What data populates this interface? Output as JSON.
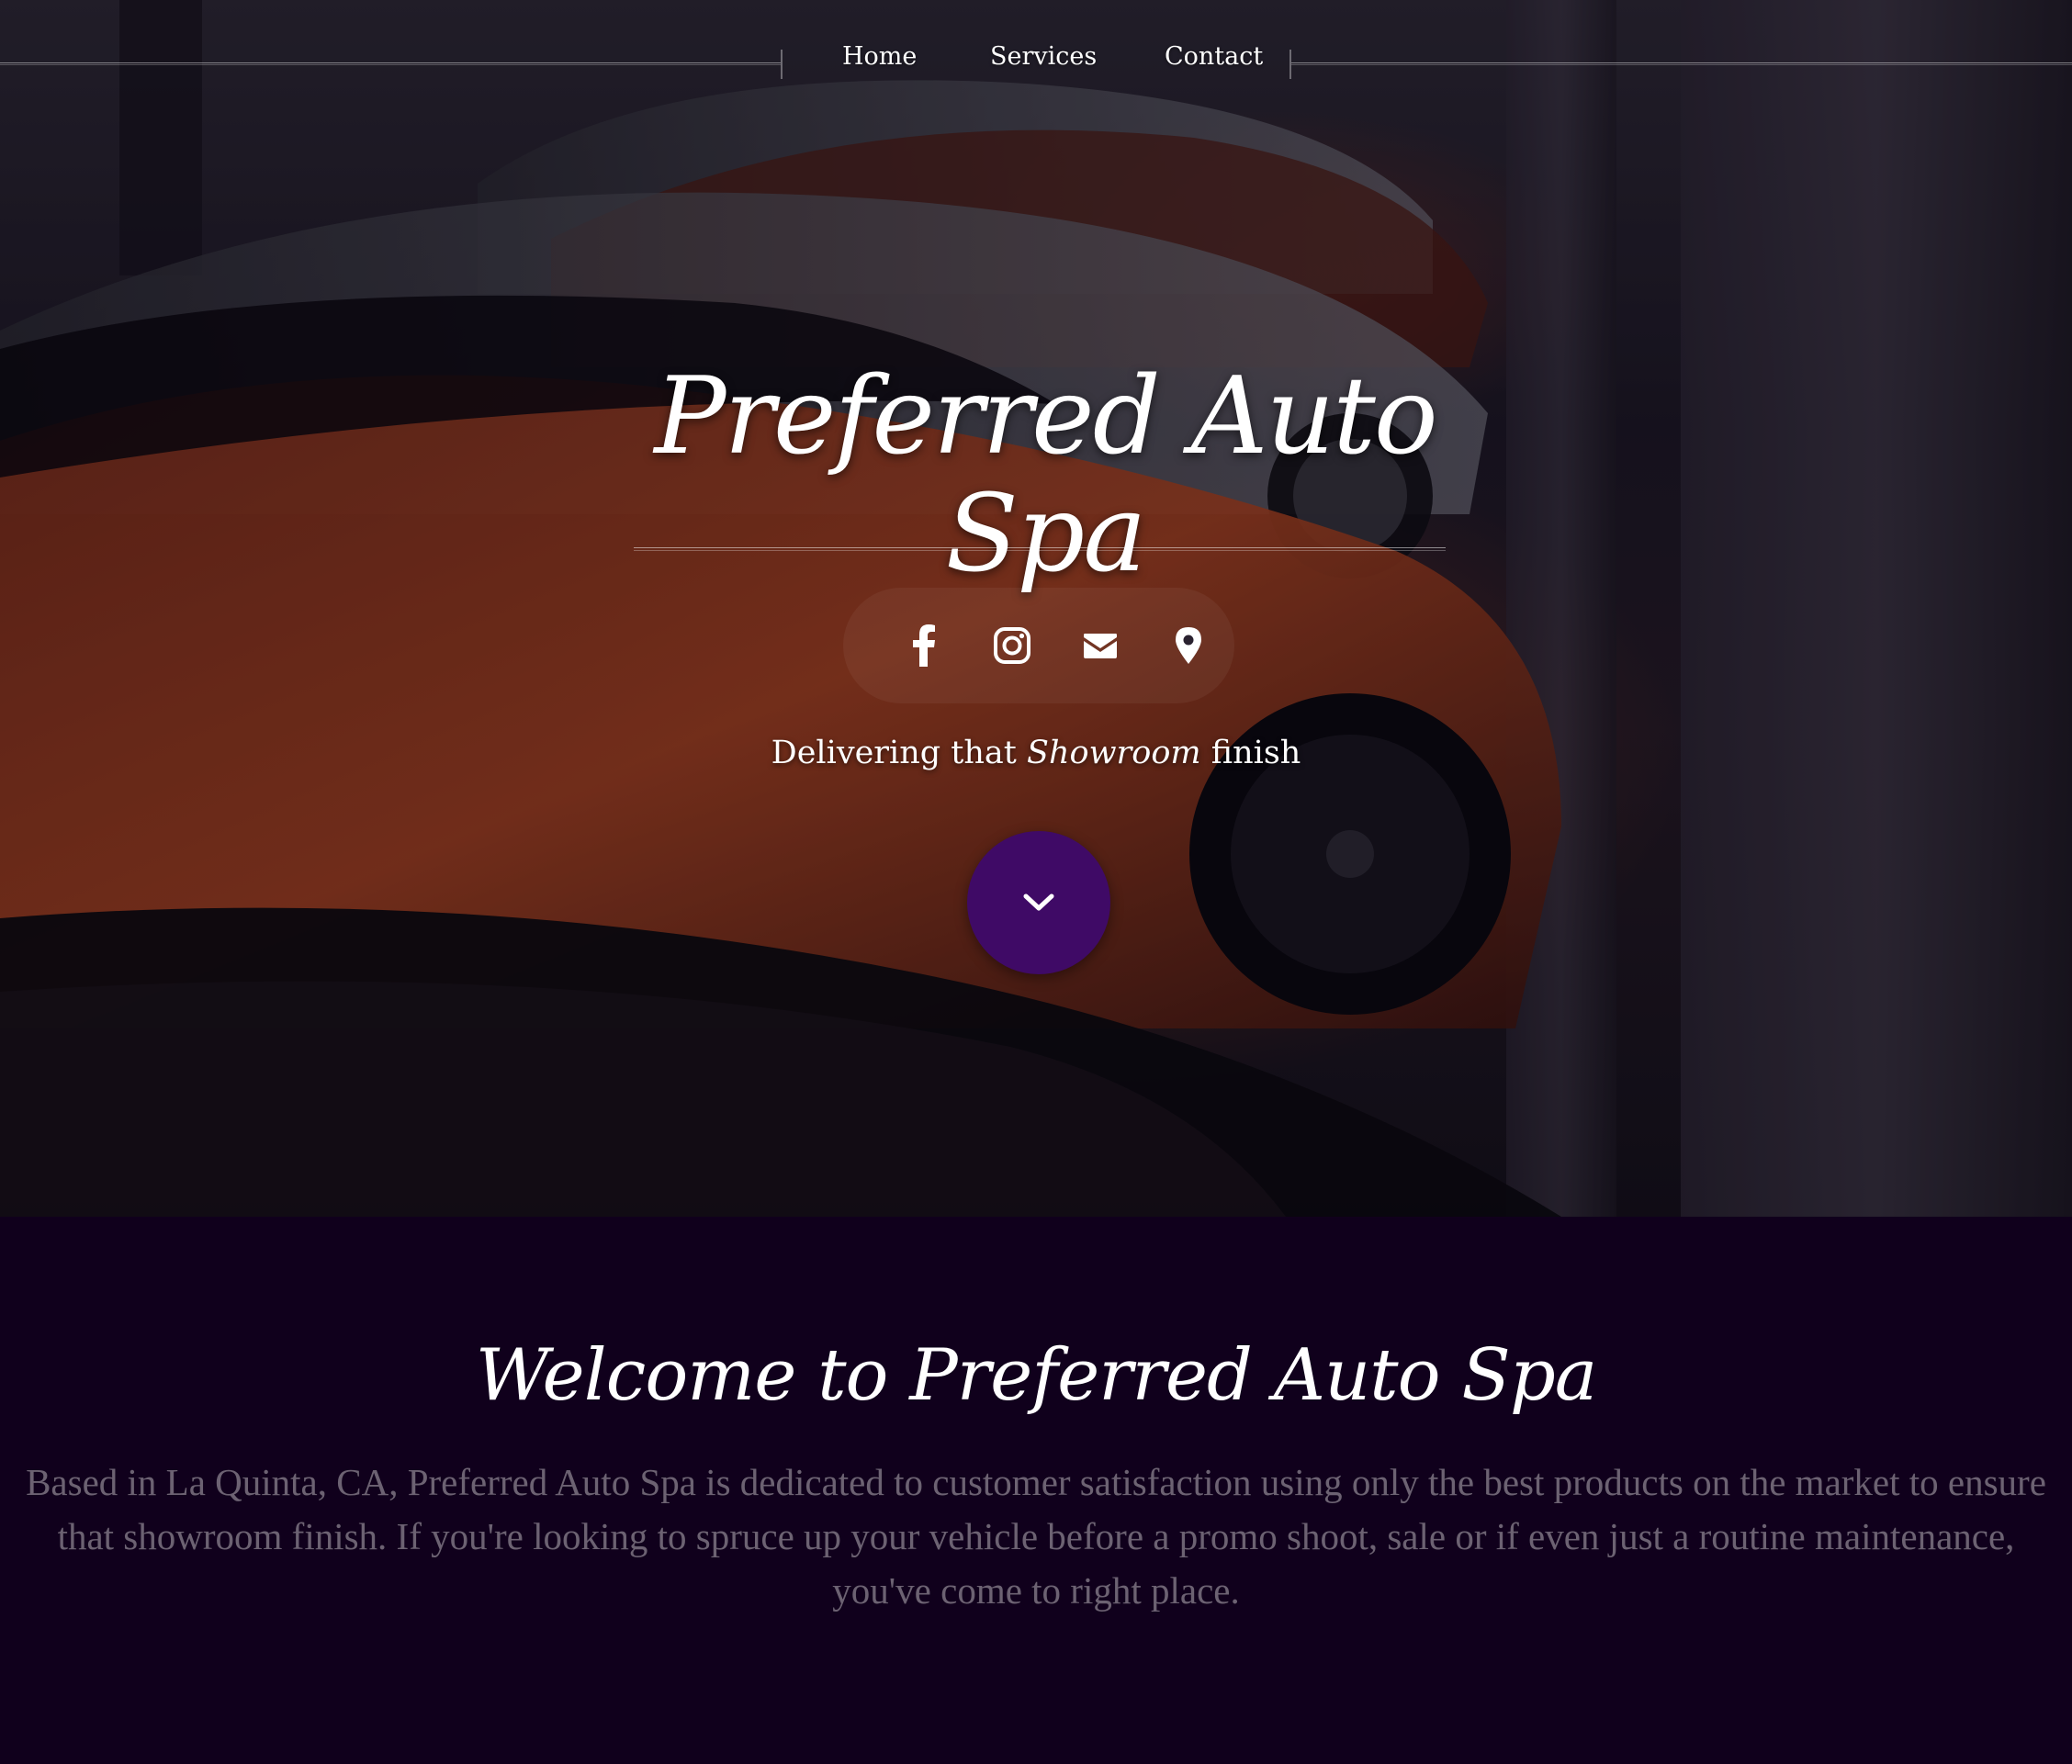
{
  "nav": {
    "items": [
      "Home",
      "Services",
      "Contact"
    ]
  },
  "hero": {
    "brand": "Preferred Auto Spa",
    "tagline_before": "Delivering that",
    "tagline_emphasis": "Showroom",
    "tagline_after": "finish",
    "social_icons": [
      "facebook-icon",
      "instagram-icon",
      "email-icon",
      "location-pin-icon"
    ],
    "scroll_icon": "chevron-down-icon",
    "accent_color": "#3f0a66"
  },
  "welcome": {
    "title": "Welcome to Preferred Auto Spa",
    "body": "Based in La Quinta, CA, Preferred Auto Spa is dedicated to customer satisfaction using only the best products on the market to ensure that showroom finish. If you're looking to spruce up your vehicle before a promo shoot, sale or if even just a routine maintenance, you've come to right place.",
    "background_color": "#10001c"
  }
}
